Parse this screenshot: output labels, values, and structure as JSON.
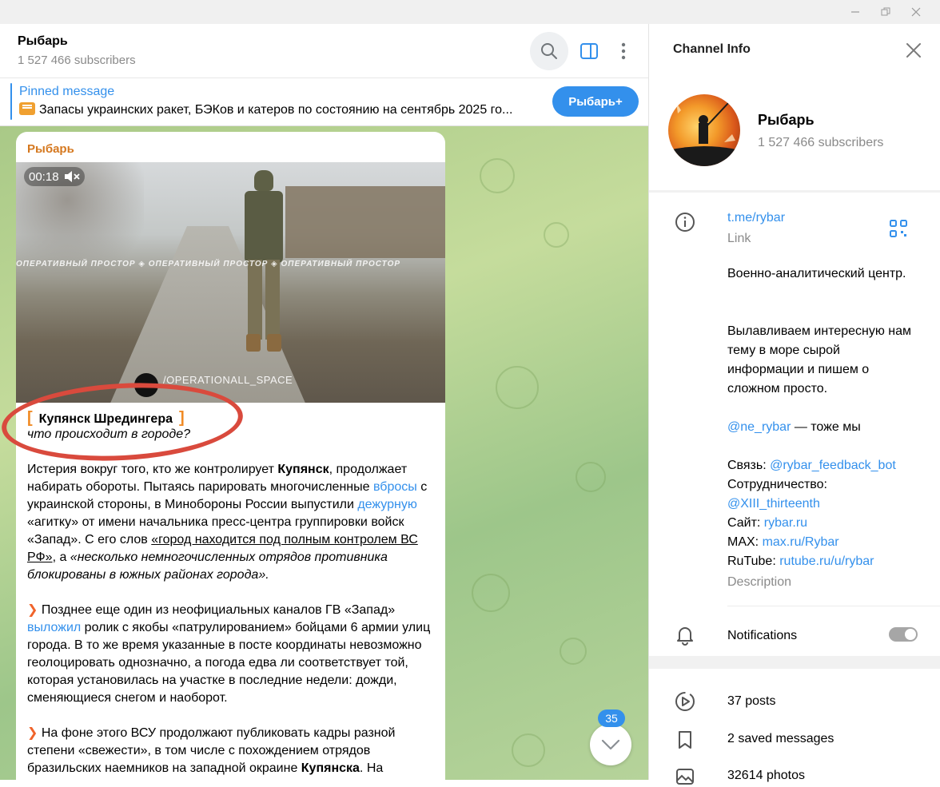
{
  "chat": {
    "title": "Рыбарь",
    "subscribers": "1 527 466 subscribers"
  },
  "pinned": {
    "label": "Pinned message",
    "text": "Запасы украинских ракет, БЭКов и катеров по состоянию на сентябрь 2025 го...",
    "button_label": "Рыбарь+"
  },
  "message": {
    "author": "Рыбарь",
    "video_duration": "00:18",
    "video_watermark": "ОПЕРАТИВНЫЙ ПРОСТОР ◈ ОПЕРАТИВНЫЙ ПРОСТОР ◈ ОПЕРАТИВНЫЙ ПРОСТОР",
    "video_handle": "/OPERATIONALL_SPACE",
    "headline_title": "Купянск Шредингера",
    "headline_subtitle": "что происходит в городе?",
    "p1": {
      "t1": "Истерия вокруг того, кто же контролирует ",
      "b1": "Купянск",
      "t2": ", продолжает набирать обороты. Пытаясь парировать многочисленные ",
      "l1": "вбросы",
      "t3": " с украинской стороны, в Минобороны России выпустили ",
      "l2": "дежурную",
      "t4": " «агитку» от имени начальника пресс-центра группировки войск «Запад». С его слов ",
      "u1": "«город находится под полным контролем ВС РФ»",
      "t5": ", а ",
      "i1": "«несколько немногочисленных отрядов противника блокированы в южных районах города»."
    },
    "p2": {
      "t1": " Позднее еще один из неофициальных каналов ГВ «Запад» ",
      "l1": "выложил",
      "t2": " ролик с якобы «патрулированием» бойцами 6 армии улиц города. В то же время указанные в посте координаты невозможно геолоцировать однозначно, а погода едва ли соответствует той, которая установилась на участке в последние недели: дожди, сменяющиеся снегом и наоборот."
    },
    "p3": {
      "t1": " На фоне этого ВСУ продолжают публиковать кадры разной степени «свежести», в том числе с похождением отрядов бразильских наемников на западной окраине ",
      "b1": "Купянска",
      "t2": ". На"
    }
  },
  "scroll": {
    "unread_count": "35"
  },
  "panel": {
    "title": "Channel Info",
    "name": "Рыбарь",
    "subscribers": "1 527 466 subscribers",
    "link": "t.me/rybar",
    "link_caption": "Link",
    "desc_1": "Военно-аналитический центр.",
    "desc_2": "Вылавливаем интересную нам тему в море сырой информации и пишем о сложном просто.",
    "desc_3_link": "@ne_rybar",
    "desc_3_text": " — тоже мы",
    "contact_label": "Связь: ",
    "contact_link": "@rybar_feedback_bot",
    "coop_label": "Сотрудничество:",
    "coop_link": "@XIII_thirteenth",
    "site_label": "Сайт: ",
    "site_link": "rybar.ru",
    "max_label": "MAX: ",
    "max_link": "max.ru/Rybar",
    "rutube_label": "RuTube: ",
    "rutube_link": "rutube.ru/u/rybar",
    "desc_caption": "Description",
    "notifications_label": "Notifications",
    "notifications_on": false,
    "media": [
      {
        "icon": "posts-icon",
        "label": "37 posts"
      },
      {
        "icon": "bookmark-icon",
        "label": "2 saved messages"
      },
      {
        "icon": "photo-icon",
        "label": "32614 photos"
      }
    ]
  },
  "colors": {
    "accent": "#3390ec",
    "author": "#d5781f",
    "annotation_red": "#d94a3d"
  }
}
